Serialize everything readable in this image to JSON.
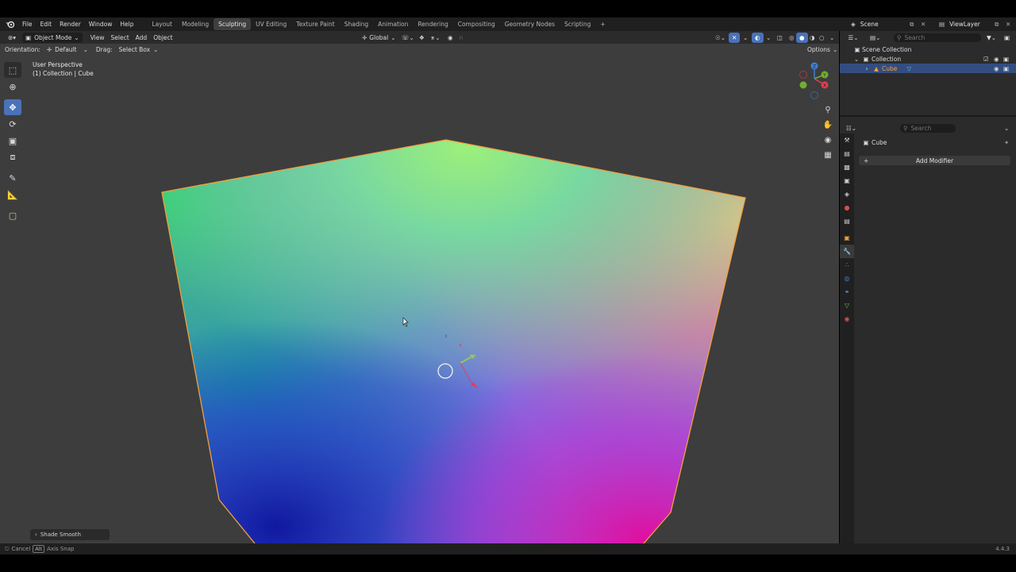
{
  "topbar": {
    "menus": [
      "File",
      "Edit",
      "Render",
      "Window",
      "Help"
    ],
    "workspaces": [
      "Layout",
      "Modeling",
      "Sculpting",
      "UV Editing",
      "Texture Paint",
      "Shading",
      "Animation",
      "Rendering",
      "Compositing",
      "Geometry Nodes",
      "Scripting"
    ],
    "active_workspace": "Sculpting",
    "add_tab": "+",
    "scene": "Scene",
    "view_layer": "ViewLayer"
  },
  "viewport_header": {
    "mode": "Object Mode",
    "menus": [
      "View",
      "Select",
      "Add",
      "Object"
    ],
    "transform_orientation": "Global",
    "orientation_label": "Orientation:",
    "orientation_value": "Default",
    "drag_label": "Drag:",
    "drag_value": "Select Box",
    "options_label": "Options"
  },
  "viewport": {
    "view_name": "User Perspective",
    "view_context": "(1) Collection | Cube",
    "last_operator": "Shade Smooth"
  },
  "gizmo": {
    "x": "X",
    "y": "Y",
    "z": "Z"
  },
  "outliner": {
    "search_placeholder": "Search",
    "scene_collection": "Scene Collection",
    "collection": "Collection",
    "object": "Cube"
  },
  "properties": {
    "search_placeholder": "Search",
    "object_name": "Cube",
    "add_modifier": "Add Modifier"
  },
  "statusbar": {
    "cancel": "Cancel",
    "alt_key": "Alt",
    "axis_snap": "Axis Snap",
    "version": "4.4.3"
  },
  "colors": {
    "accent": "#4a72b8",
    "selection_outline": "#f0a040",
    "axis_x": "#e04050",
    "axis_y": "#70b030",
    "axis_z": "#4080d0"
  }
}
